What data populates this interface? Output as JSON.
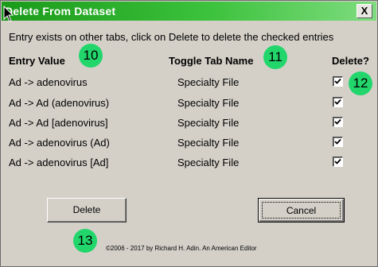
{
  "window": {
    "title": "Delete From Dataset",
    "close_label": "X"
  },
  "instruction": "Entry exists on other tabs, click on Delete to delete the checked entries",
  "columns": {
    "entry": "Entry Value",
    "toggle": "Toggle Tab Name",
    "delete": "Delete?"
  },
  "rows": [
    {
      "entry": "Ad -> adenovirus",
      "tab": "Specialty File",
      "checked": true
    },
    {
      "entry": "Ad -> Ad (adenovirus)",
      "tab": "Specialty File",
      "checked": true
    },
    {
      "entry": "Ad -> Ad [adenovirus]",
      "tab": "Specialty File",
      "checked": true
    },
    {
      "entry": "Ad -> adenovirus (Ad)",
      "tab": "Specialty File",
      "checked": true
    },
    {
      "entry": "Ad -> adenovirus [Ad]",
      "tab": "Specialty File",
      "checked": true
    }
  ],
  "buttons": {
    "delete": "Delete",
    "cancel": "Cancel"
  },
  "copyright": "©2006 - 2017 by Richard H. Adin. An American Editor",
  "badges": [
    "10",
    "11",
    "12",
    "13"
  ],
  "colors": {
    "titlebar": "#1a9a1a",
    "badge": "#22d66c",
    "dialog_bg": "#d4d0c8"
  }
}
